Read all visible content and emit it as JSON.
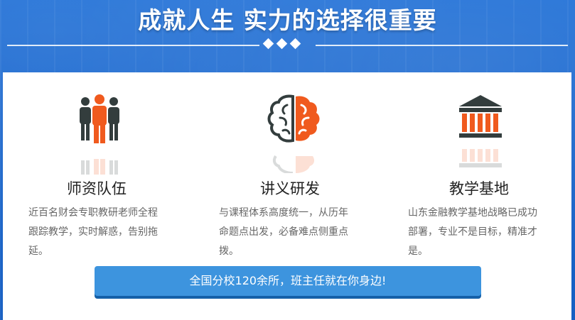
{
  "header": {
    "title": "成就人生 实力的选择很重要"
  },
  "features": [
    {
      "icon": "team-people-icon",
      "title": "师资队伍",
      "desc_lines": [
        "近百名财会专职教研老师全程",
        "跟踪教学，实时解惑，告别拖",
        "延。"
      ]
    },
    {
      "icon": "brain-icon",
      "title": "讲义研发",
      "desc_lines": [
        "与课程体系高度统一，从历年",
        "命题点出发，必备难点侧重点",
        "拨。"
      ]
    },
    {
      "icon": "institution-building-icon",
      "title": "教学基地",
      "desc_lines": [
        "山东金融教学基地战略已成功",
        "部署，专业不是目标，精准才",
        "是。"
      ]
    }
  ],
  "cta": {
    "label": "全国分校120余所，班主任就在你身边!"
  },
  "colors": {
    "accent_orange": "#f05a1e",
    "icon_dark": "#333d3d",
    "button_blue": "#3d94de",
    "background_blue": "#1a66cc"
  }
}
